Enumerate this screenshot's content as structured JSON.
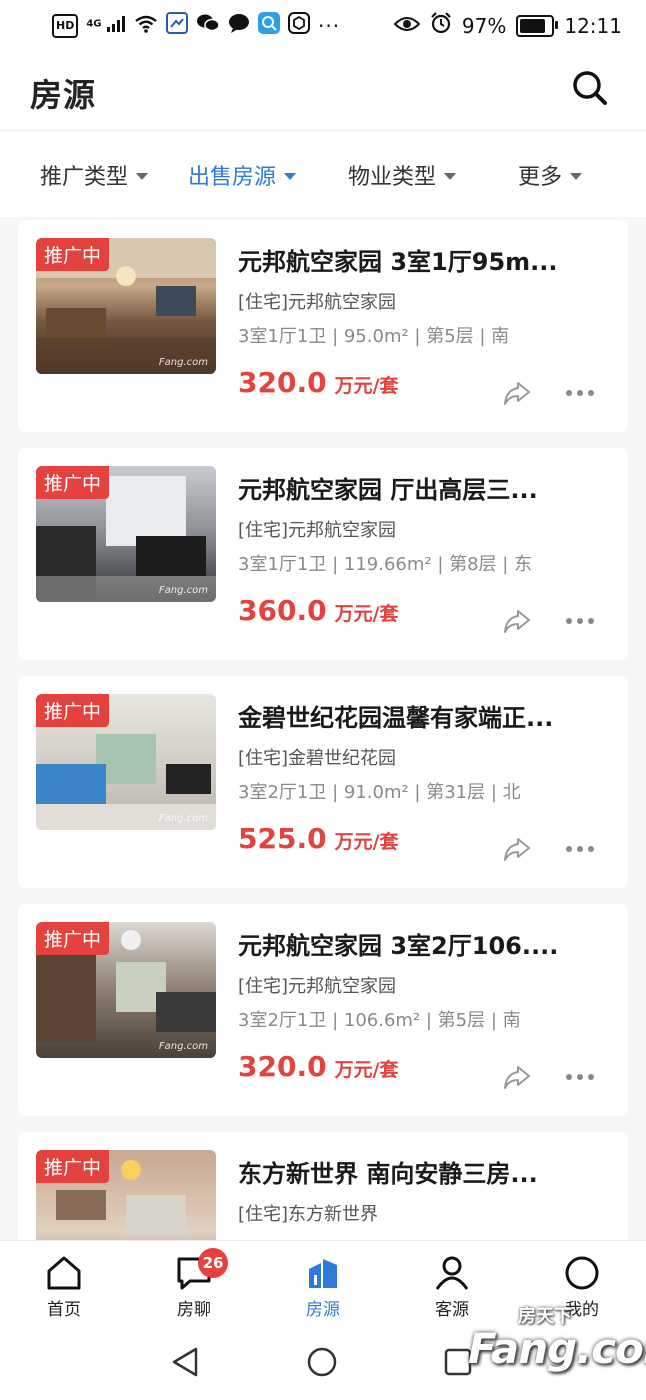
{
  "status_bar": {
    "network": "HD",
    "signal": "4G",
    "battery_percent": "97%",
    "battery_level": 0.97,
    "time": "12:11"
  },
  "header": {
    "title": "房源"
  },
  "filters": [
    {
      "label": "推广类型",
      "active": false
    },
    {
      "label": "出售房源",
      "active": true
    },
    {
      "label": "物业类型",
      "active": false
    },
    {
      "label": "更多",
      "active": false
    }
  ],
  "listings": [
    {
      "badge": "推广中",
      "title": "元邦航空家园 3室1厅95m...",
      "sub": "[住宅]元邦航空家园",
      "attrs": "3室1厅1卫 | 95.0m² | 第5层 | 南",
      "price": "320.0",
      "unit": "万元/套",
      "watermark": "Fang.com"
    },
    {
      "badge": "推广中",
      "title": "元邦航空家园 厅出高层三...",
      "sub": "[住宅]元邦航空家园",
      "attrs": "3室1厅1卫 | 119.66m² | 第8层 | 东",
      "price": "360.0",
      "unit": "万元/套",
      "watermark": "Fang.com"
    },
    {
      "badge": "推广中",
      "title": "金碧世纪花园温馨有家端正...",
      "sub": "[住宅]金碧世纪花园",
      "attrs": "3室2厅1卫 | 91.0m² | 第31层 | 北",
      "price": "525.0",
      "unit": "万元/套",
      "watermark": "Fang.com"
    },
    {
      "badge": "推广中",
      "title": "元邦航空家园 3室2厅106....",
      "sub": "[住宅]元邦航空家园",
      "attrs": "3室2厅1卫 | 106.6m² | 第5层 | 南",
      "price": "320.0",
      "unit": "万元/套",
      "watermark": "Fang.com"
    },
    {
      "badge": "推广中",
      "title": "东方新世界 南向安静三房...",
      "sub": "[住宅]东方新世界",
      "attrs": "",
      "price": "",
      "unit": "",
      "watermark": ""
    }
  ],
  "tabs": [
    {
      "label": "首页",
      "icon": "home-icon"
    },
    {
      "label": "房聊",
      "icon": "chat-icon",
      "badge": "26"
    },
    {
      "label": "房源",
      "icon": "listings-icon",
      "active": true
    },
    {
      "label": "客源",
      "icon": "person-icon"
    },
    {
      "label": "我的",
      "icon": "profile-icon"
    }
  ],
  "watermark_logo": {
    "top": "房天下",
    "main": "Fang.com"
  },
  "colors": {
    "accent": "#2f7ad8",
    "price": "#e3423e",
    "badge": "#e3423e"
  }
}
